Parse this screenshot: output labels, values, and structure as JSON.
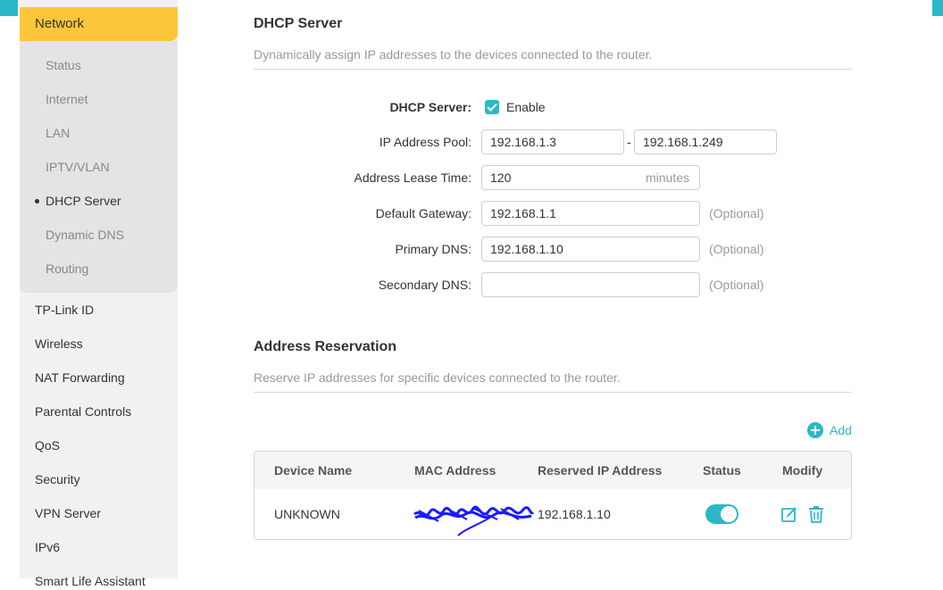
{
  "sidebar": {
    "active_section": "Network",
    "sub_items": [
      {
        "label": "Status",
        "active": false
      },
      {
        "label": "Internet",
        "active": false
      },
      {
        "label": "LAN",
        "active": false
      },
      {
        "label": "IPTV/VLAN",
        "active": false
      },
      {
        "label": "DHCP Server",
        "active": true
      },
      {
        "label": "Dynamic DNS",
        "active": false
      },
      {
        "label": "Routing",
        "active": false
      }
    ],
    "items": [
      {
        "label": "TP-Link ID"
      },
      {
        "label": "Wireless"
      },
      {
        "label": "NAT Forwarding"
      },
      {
        "label": "Parental Controls"
      },
      {
        "label": "QoS"
      },
      {
        "label": "Security"
      },
      {
        "label": "VPN Server"
      },
      {
        "label": "IPv6"
      },
      {
        "label": "Smart Life Assistant"
      }
    ]
  },
  "dhcp": {
    "title": "DHCP Server",
    "description": "Dynamically assign IP addresses to the devices connected to the router.",
    "server_label": "DHCP Server:",
    "enable_label": "Enable",
    "enabled": true,
    "pool_label": "IP Address Pool:",
    "pool_start": "192.168.1.3",
    "pool_separator": "-",
    "pool_end": "192.168.1.249",
    "lease_label": "Address Lease Time:",
    "lease_value": "120",
    "lease_unit": "minutes",
    "gateway_label": "Default Gateway:",
    "gateway_value": "192.168.1.1",
    "primary_dns_label": "Primary DNS:",
    "primary_dns_value": "192.168.1.10",
    "secondary_dns_label": "Secondary DNS:",
    "secondary_dns_value": "",
    "optional_text": "(Optional)"
  },
  "reservation": {
    "title": "Address Reservation",
    "description": "Reserve IP addresses for specific devices connected to the router.",
    "add_label": "Add",
    "columns": [
      "Device Name",
      "MAC Address",
      "Reserved IP Address",
      "Status",
      "Modify"
    ],
    "rows": [
      {
        "device_name": "UNKNOWN",
        "mac": "",
        "ip": "192.168.1.10",
        "status_on": true
      }
    ]
  },
  "colors": {
    "accent": "#2ab8c9",
    "active_nav": "#fcc63b",
    "redaction": "#1a1aff"
  }
}
